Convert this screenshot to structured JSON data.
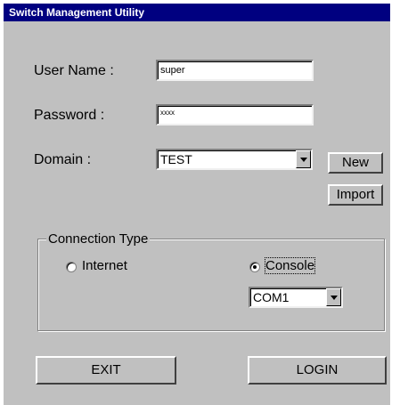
{
  "window": {
    "title": "Switch Management Utility"
  },
  "form": {
    "username_label": "User Name :",
    "username_value": "super",
    "password_label": "Password :",
    "password_value": "xxxx",
    "domain_label": "Domain :",
    "domain_value": "TEST",
    "new_label": "New",
    "import_label": "Import"
  },
  "connection": {
    "group_label": "Connection Type",
    "internet_label": "Internet",
    "internet_selected": false,
    "console_label": "Console",
    "console_selected": true,
    "port_value": "COM1"
  },
  "actions": {
    "exit_label": "EXIT",
    "login_label": "LOGIN"
  },
  "colors": {
    "titlebar": "#000080",
    "face": "#c0c0c0"
  }
}
